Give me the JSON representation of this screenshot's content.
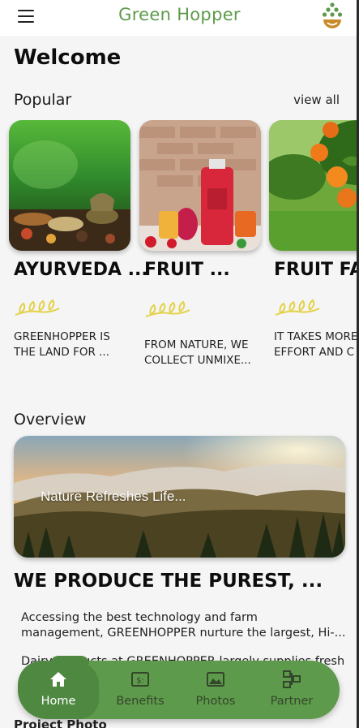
{
  "app": {
    "title": "Green Hopper"
  },
  "welcome": "Welcome",
  "popular": {
    "title": "Popular",
    "view_all": "view all",
    "cards": [
      {
        "title": "AYURVEDA ...",
        "desc_line1": "GREENHOPPER IS",
        "desc_line2": "THE LAND FOR ..."
      },
      {
        "title": "FRUIT ...",
        "desc_line1": "FROM NATURE, WE",
        "desc_line2": "COLLECT UNMIXE..."
      },
      {
        "title": "FRUIT FAR",
        "desc_line1": "IT TAKES MORE",
        "desc_line2": "EFFORT AND C"
      }
    ]
  },
  "overview": {
    "title": "Overview",
    "caption": "Nature Refreshes Life...",
    "headline": "WE PRODUCE THE PUREST, ...",
    "para1_line1": "Accessing the best technology and farm",
    "para1_line2": "management, GREENHOPPER nurture the largest, Hi-...",
    "para2_line1": "Dairy products at GREENHOPPER largely supplies fresh"
  },
  "peek_text": "Project Photo",
  "nav": [
    {
      "label": "Home",
      "icon": "home-icon",
      "active": true
    },
    {
      "label": "Benefits",
      "icon": "money-icon",
      "active": false
    },
    {
      "label": "Photos",
      "icon": "image-icon",
      "active": false
    },
    {
      "label": "Partner",
      "icon": "network-icon",
      "active": false
    }
  ],
  "colors": {
    "brand": "#5d9a4a",
    "nav_bg": "#5e9a4b",
    "nav_active": "#4f8840",
    "leaf": "#e3d24a"
  }
}
